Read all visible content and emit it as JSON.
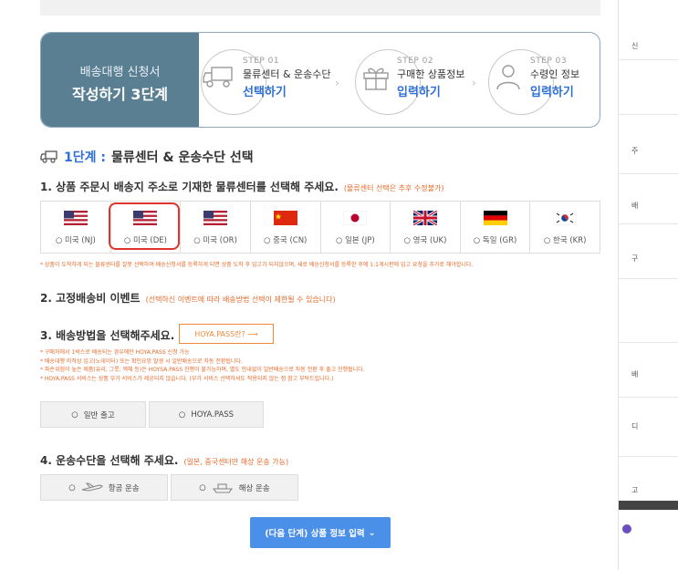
{
  "hero": {
    "sub": "배송대행 신청서",
    "main": "작성하기 3단계"
  },
  "steps": [
    {
      "num": "STEP 01",
      "line1": "물류센터 & 운송수단",
      "line2": "선택하기"
    },
    {
      "num": "STEP 02",
      "line1": "구매한 상품정보",
      "line2": "입력하기"
    },
    {
      "num": "STEP 03",
      "line1": "수령인 정보",
      "line2": "입력하기"
    }
  ],
  "section": {
    "prefix": "1단계 :",
    "title": "물류센터 & 운송수단 선택"
  },
  "q1": {
    "label": "1. 상품 주문시 배송지 주소로 기재한 물류센터를 선택해 주세요.",
    "note": "(물류센터 선택은 추후 수정불가)"
  },
  "centers": [
    {
      "label": "미국 (NJ)",
      "flag": "us-flag"
    },
    {
      "label": "미국 (DE)",
      "flag": "us-flag"
    },
    {
      "label": "미국 (OR)",
      "flag": "us-flag"
    },
    {
      "label": "중국 (CN)",
      "flag": "cn-flag"
    },
    {
      "label": "일본 (JP)",
      "flag": "jp-flag"
    },
    {
      "label": "영국 (UK)",
      "flag": "uk-flag"
    },
    {
      "label": "독일 (GR)",
      "flag": "de-flag"
    },
    {
      "label": "한국 (KR)",
      "flag": "kr-flag"
    }
  ],
  "warn1": "* 상품이 도착하게 되는 물류센터를 잘못 선택하여 배송신청서를 등록하게 되면 상품 도착 후 입고가 되지않으며, 새로 배송신청서를 등록한 후에 1:1게시판에 입고 요청을 추가로 해야합니다.",
  "q2": {
    "label": "2. 고정배송비 이벤트",
    "note": "(선택하신 이벤트에 따라 배송방법 선택이 제한될 수 있습니다)"
  },
  "q3": {
    "label": "3. 배송방법을 선택해주세요.",
    "hoya_btn": "HOYA.PASS란? ⟶"
  },
  "warn3": [
    "* 구매처에서 1박스로 배송되는 경우에만 HOYA.PASS 신청 가능",
    "* 배송대행 미작성 입고(노데이터) 또는 확인요망 발생 시 일반배송으로 자동 전환됩니다.",
    "* 파손위험이 높은 제품(유리, 그릇, 액체 등)은 HOYSA.PASS 진행이 불가능하며, 별도 안내없이 일반배송으로 자동 전환 후 출고 진행됩니다.",
    "* HOYA.PASS 서비스는 상품 부가 서비스가 제공되지 않습니다. (부가 서비스 선택하셔도 적용되지 않는 점 참고 부탁드립니다.)"
  ],
  "ship_methods": [
    "일반 출고",
    "HOYA.PASS"
  ],
  "q4": {
    "label": "4. 운송수단을 선택해 주세요.",
    "note": "(일본, 중국센터만 해상 운송 가능)"
  },
  "transports": [
    "항공 운송",
    "해상 운송"
  ],
  "next_btn": "(다음 단계) 상품 정보 입력",
  "sidebar_chars": [
    "신",
    "주",
    "배",
    "구",
    "배",
    "디",
    "고"
  ],
  "colors": {
    "accent_blue": "#2f6fd6",
    "hero_bg": "#5a7f93",
    "warning": "#e86a2a",
    "highlight": "#e0332b",
    "button": "#4a8fe8"
  }
}
